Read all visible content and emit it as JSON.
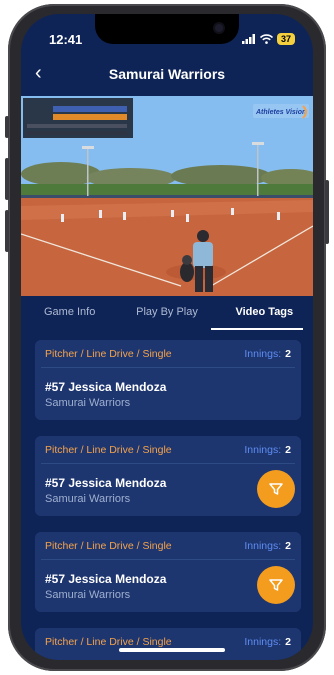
{
  "status": {
    "time": "12:41",
    "battery": "37"
  },
  "nav": {
    "back_glyph": "‹",
    "title": "Samurai Warriors"
  },
  "video": {
    "brand": "Athletes Vision"
  },
  "tabs": [
    {
      "label": "Game Info",
      "active": false
    },
    {
      "label": "Play By Play",
      "active": false
    },
    {
      "label": "Video Tags",
      "active": true
    }
  ],
  "cards": [
    {
      "play": "Pitcher / Line Drive / Single",
      "innings_label": "Innings:",
      "innings_value": "2",
      "player": "#57 Jessica Mendoza",
      "team": "Samurai Warriors",
      "has_filter": false
    },
    {
      "play": "Pitcher / Line Drive / Single",
      "innings_label": "Innings:",
      "innings_value": "2",
      "player": "#57 Jessica Mendoza",
      "team": "Samurai Warriors",
      "has_filter": true
    },
    {
      "play": "Pitcher / Line Drive / Single",
      "innings_label": "Innings:",
      "innings_value": "2",
      "player": "#57 Jessica Mendoza",
      "team": "Samurai Warriors",
      "has_filter": true
    },
    {
      "play": "Pitcher / Line Drive / Single",
      "innings_label": "Innings:",
      "innings_value": "2",
      "player": "",
      "team": "",
      "has_filter": false
    }
  ],
  "colors": {
    "background": "#0f2456",
    "card": "#1e3670",
    "accent": "#f39c1e",
    "play_text": "#f5a24a",
    "innings_text": "#5d8cf0"
  }
}
